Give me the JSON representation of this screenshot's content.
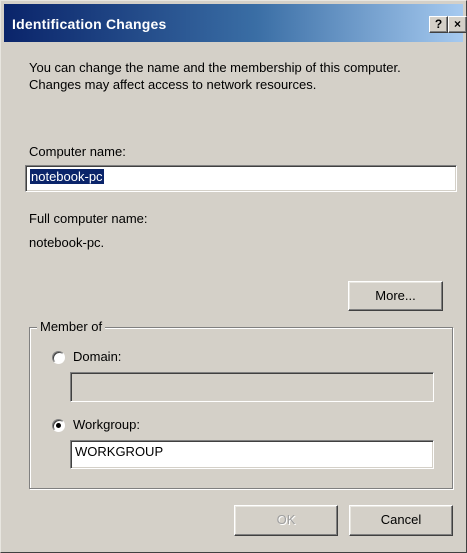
{
  "window": {
    "title": "Identification Changes",
    "help_button": "?",
    "close_button": "×"
  },
  "description": "You can change the name and the membership of this computer. Changes may affect access to network resources.",
  "computer_name": {
    "label": "Computer name:",
    "value": "notebook-pc"
  },
  "full_computer_name": {
    "label": "Full computer name:",
    "value": "notebook-pc."
  },
  "more_button": "More...",
  "member_of": {
    "title": "Member of",
    "domain": {
      "label": "Domain:",
      "selected": false,
      "value": ""
    },
    "workgroup": {
      "label": "Workgroup:",
      "selected": true,
      "value": "WORKGROUP"
    }
  },
  "buttons": {
    "ok": "OK",
    "cancel": "Cancel"
  },
  "colors": {
    "titlebar_start": "#0a246a",
    "titlebar_end": "#a6caf0",
    "dialog_face": "#d4d0c8",
    "selection": "#0a246a"
  }
}
